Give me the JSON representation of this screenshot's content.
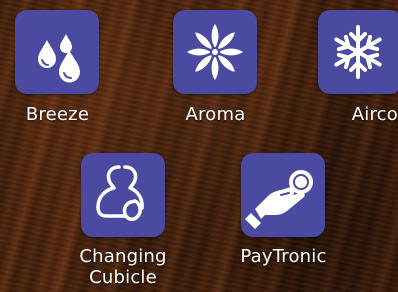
{
  "services": [
    {
      "label": "Breeze",
      "icon": "water-drops-icon"
    },
    {
      "label": "Aroma",
      "icon": "flower-icon"
    },
    {
      "label": "Airco",
      "icon": "snowflake-icon"
    },
    {
      "label_line1": "Changing",
      "label_line2": "Cubicle",
      "icon": "changing-cubicle-icon"
    },
    {
      "label": "PayTronic",
      "icon": "hand-coin-icon"
    }
  ],
  "colors": {
    "tile": "#4a4aa0",
    "icon": "#ffffff",
    "label": "#ffffff"
  }
}
